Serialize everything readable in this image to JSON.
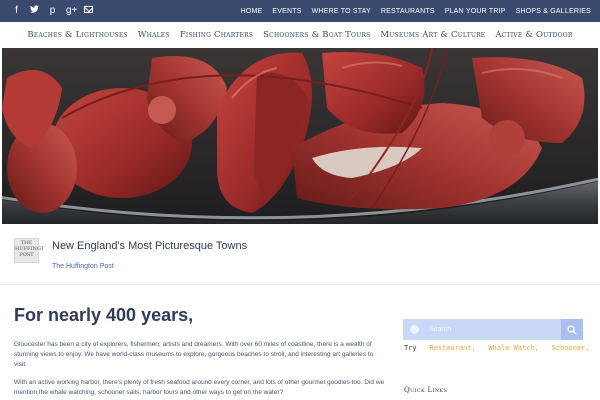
{
  "topbar": {
    "social": [
      {
        "icon": "facebook-icon",
        "glyph": "f"
      },
      {
        "icon": "twitter-icon",
        "glyph": "ᶡ"
      },
      {
        "icon": "pinterest-icon",
        "glyph": "p"
      },
      {
        "icon": "google-plus-icon",
        "glyph": "g+"
      },
      {
        "icon": "mail-icon",
        "glyph": ""
      }
    ],
    "nav": [
      "HOME",
      "EVENTS",
      "WHERE TO STAY",
      "RESTAURANTS",
      "PLAN YOUR TRIP",
      "SHOPS & GALLERIES"
    ],
    "background": "#3a4a6e"
  },
  "mainnav": [
    "Beaches & Lighthouses",
    "Whales",
    "Fishing Charters",
    "Schooners & Boat Tours",
    "Museums Art & Culture",
    "Active & Outdoor"
  ],
  "article": {
    "logo_lines": [
      "THE",
      "HUFFINGT",
      "POST"
    ],
    "title": "New England's Most Picturesque Towns",
    "source": "The Huffington Post"
  },
  "main": {
    "headline": "For nearly 400 years,",
    "paragraph1": "Gloucester has been a city of explorers, fishermen, artists and dreamers. With over 60 miles of coastline, there is a wealth of stunning views to enjoy. We have world-class museums to explore, gorgeous beaches to stroll, and interesting art galleries to visit.",
    "paragraph2": "With an active working harbor, there's plenty of fresh seafood around every corner, and lots of other gourmet goodies too. Did we mention the whale watching, schooner sails, harbor tours and other ways to get on the water?"
  },
  "sidebar": {
    "search_placeholder": "Search",
    "try_label": "Try",
    "suggestions": [
      "Restaurant,",
      "Whale Watch,",
      "Schooner,"
    ],
    "quick_links": "Quick Links"
  },
  "colors": {
    "accent": "#3a4a6e",
    "link": "#4a67b0",
    "suggestion": "#f0a33a",
    "search_bg": "#c9d8f6"
  }
}
